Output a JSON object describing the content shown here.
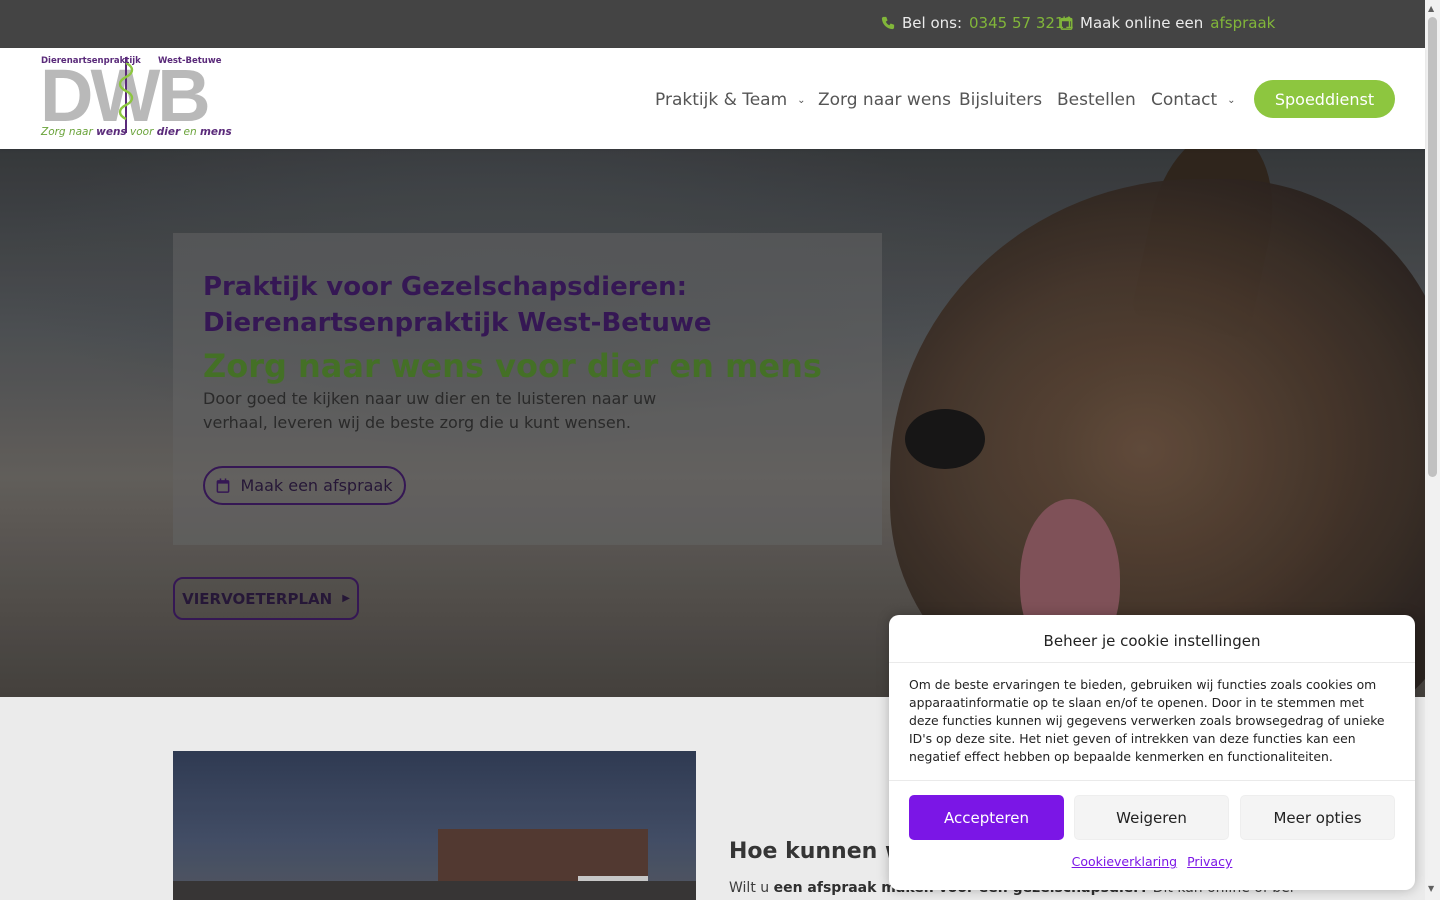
{
  "topbar": {
    "phone_prefix": "Bel ons:",
    "phone_number": "0345 57 3211",
    "appointment_prefix": "Maak online een",
    "appointment_link": "afspraak",
    "phone_icon": "phone-icon",
    "calendar_icon": "calendar-icon"
  },
  "logo": {
    "top_left": "Dierenartsenpraktijk",
    "top_right": "West-Betuwe",
    "letters": "DWB",
    "tagline_1": "Zorg naar",
    "tagline_2": "wens",
    "tagline_3": "voor",
    "tagline_4": "dier",
    "tagline_5": "en",
    "tagline_6": "mens"
  },
  "nav": {
    "items": [
      {
        "label": "Praktijk & Team",
        "has_dropdown": true
      },
      {
        "label": "Zorg naar wens",
        "has_dropdown": false
      },
      {
        "label": "Bijsluiters",
        "has_dropdown": false
      },
      {
        "label": "Bestellen",
        "has_dropdown": false
      },
      {
        "label": "Contact",
        "has_dropdown": true
      }
    ],
    "cta": "Spoeddienst"
  },
  "hero": {
    "title": "Praktijk voor Gezelschapsdieren: Dierenartsenpraktijk West-Betuwe",
    "subtitle": "Zorg naar wens voor dier en mens",
    "text": "Door goed te kijken naar uw dier en te luisteren naar uw verhaal, leveren wij de beste zorg die u kunt wensen.",
    "button": "Maak een afspraak",
    "secondary_button": "VIERVOETERPLAN"
  },
  "section": {
    "title": "Hoe kunnen w",
    "text_prefix": "Wilt u",
    "text_bold": "een afspraak maken voor een gezelschapsdier?",
    "text_suffix": "Dit kan online of bel"
  },
  "cookie": {
    "title": "Beheer je cookie instellingen",
    "text": "Om de beste ervaringen te bieden, gebruiken wij functies zoals cookies om apparaatinformatie op te slaan en/of te openen. Door in te stemmen met deze functies kunnen wij gegevens verwerken zoals browsegedrag of unieke ID's op deze site. Het niet geven of intrekken van deze functies kan een negatief effect hebben op bepaalde kenmerken en functionaliteiten.",
    "accept": "Accepteren",
    "deny": "Weigeren",
    "more": "Meer opties",
    "link_1": "Cookieverklaring",
    "link_2": "Privacy"
  },
  "colors": {
    "brand_green": "#8dc63f",
    "brand_purple": "#3a1a5c",
    "cookie_accent": "#7b16e6"
  }
}
